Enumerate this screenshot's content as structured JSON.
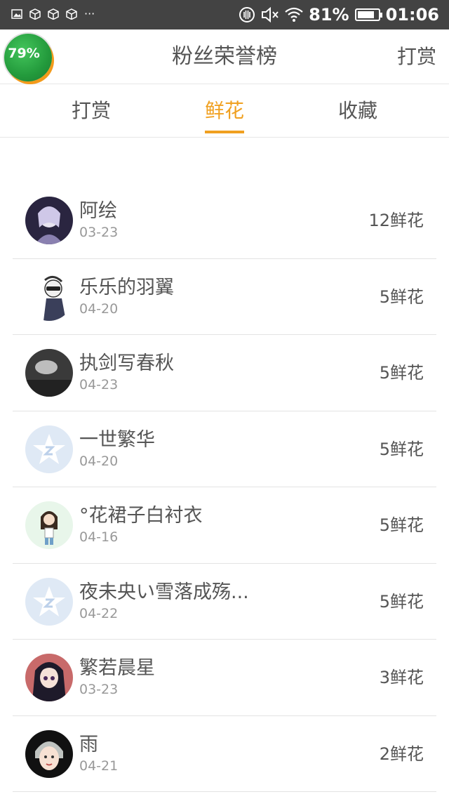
{
  "status_bar": {
    "battery_percent": "81%",
    "battery_level": 0.81,
    "time": "01:06",
    "overflow": "···"
  },
  "header": {
    "badge": "79%",
    "title": "粉丝荣誉榜",
    "action": "打赏"
  },
  "tabs": [
    {
      "label": "打赏",
      "active": false
    },
    {
      "label": "鲜花",
      "active": true
    },
    {
      "label": "收藏",
      "active": false
    }
  ],
  "accent_color": "#f0a020",
  "fans": [
    {
      "name": "阿绘",
      "date": "03-23",
      "amount": "12鲜花",
      "avatar": "anime-avatar"
    },
    {
      "name": "乐乐的羽翼",
      "date": "04-20",
      "amount": "5鲜花",
      "avatar": "sketch-avatar"
    },
    {
      "name": "执剑写春秋",
      "date": "04-23",
      "amount": "5鲜花",
      "avatar": "dark-photo-avatar"
    },
    {
      "name": "一世繁华",
      "date": "04-20",
      "amount": "5鲜花",
      "avatar": "default-star-avatar"
    },
    {
      "name": "°花裙子白衬衣",
      "date": "04-16",
      "amount": "5鲜花",
      "avatar": "girl-cartoon-avatar"
    },
    {
      "name": "夜未央い雪落成殇...",
      "date": "04-22",
      "amount": "5鲜花",
      "avatar": "default-star-avatar"
    },
    {
      "name": "繁若晨星",
      "date": "03-23",
      "amount": "3鲜花",
      "avatar": "anime-girl-avatar"
    },
    {
      "name": "雨",
      "date": "04-21",
      "amount": "2鲜花",
      "avatar": "cartoon-lady-avatar"
    }
  ]
}
